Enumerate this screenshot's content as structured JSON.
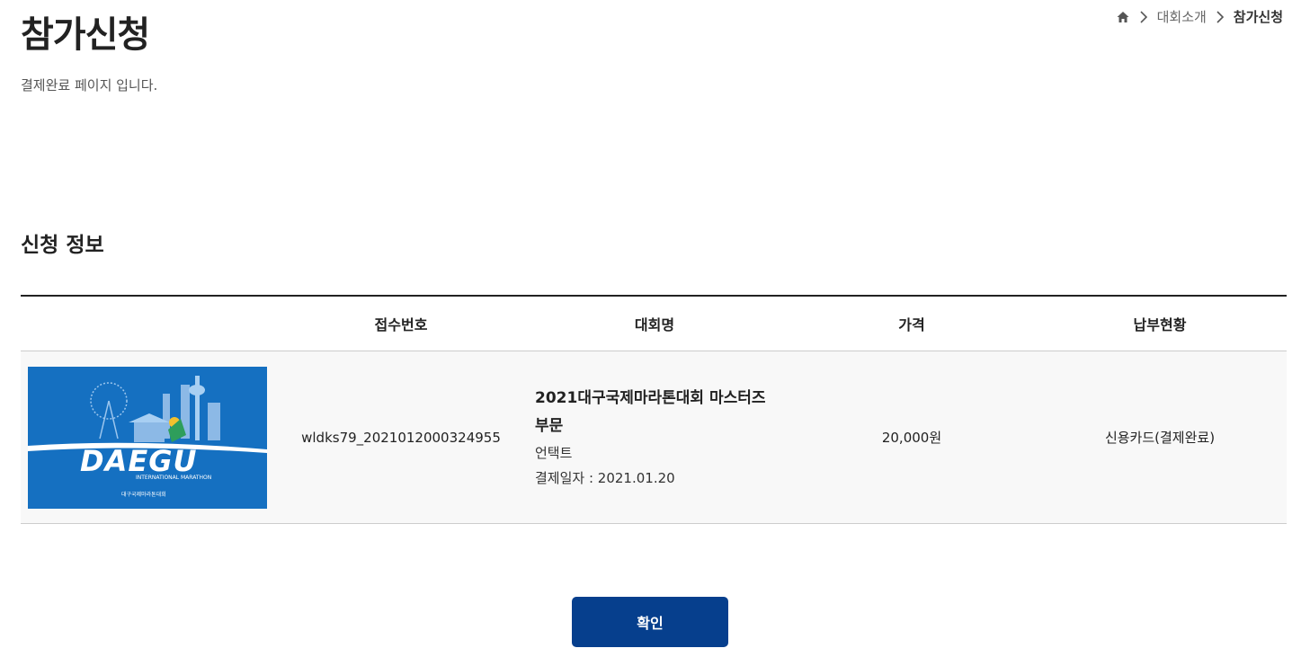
{
  "header": {
    "title": "참가신청",
    "subtitle": "결제완료 페이지 입니다."
  },
  "breadcrumb": {
    "home_icon": "home-icon",
    "items": [
      "대회소개",
      "참가신청"
    ]
  },
  "section": {
    "title": "신청 정보"
  },
  "table": {
    "headers": [
      "",
      "접수번호",
      "대회명",
      "가격",
      "납부현황"
    ],
    "rows": [
      {
        "thumbnail": {
          "logo_text": "DAEGU",
          "sub_text": "INTERNATIONAL MARATHON",
          "org_text": "대구국제마라톤대회"
        },
        "receipt_no": "wldks79_2021012000324955",
        "race_title_line1": "2021대구국제마라톤대회 마스터즈",
        "race_title_line2": "부문",
        "race_type": "언택트",
        "payment_date": "결제일자 : 2021.01.20",
        "price": "20,000원",
        "status": "신용카드(결제완료)"
      }
    ]
  },
  "actions": {
    "confirm_label": "확인"
  },
  "colors": {
    "primary_button": "#063f8d",
    "thumbnail_bg": "#1570c1",
    "row_bg": "#f8f8f8"
  }
}
